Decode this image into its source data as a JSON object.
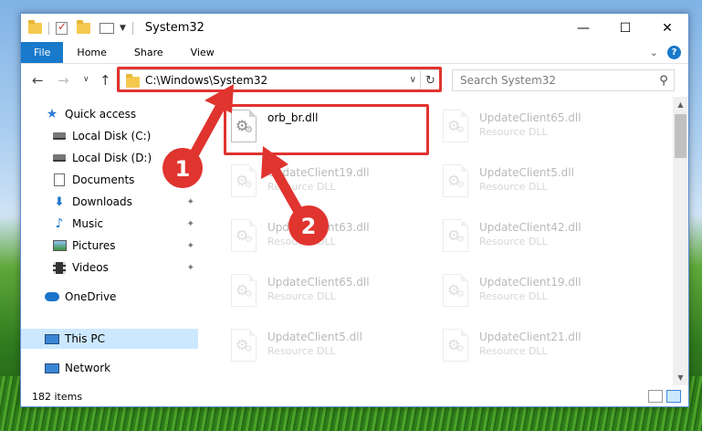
{
  "window": {
    "title": "System32",
    "controls": {
      "minimize": "—",
      "maximize": "☐",
      "close": "✕"
    }
  },
  "ribbon": {
    "tabs": [
      "File",
      "Home",
      "Share",
      "View"
    ],
    "help": "?"
  },
  "nav": {
    "address": "C:\\Windows\\System32",
    "search_placeholder": "Search System32"
  },
  "sidebar": {
    "items": [
      {
        "label": "Quick access",
        "icon": "star-icon",
        "pinned": false
      },
      {
        "label": "Local Disk (C:)",
        "icon": "drive-icon",
        "pinned": false
      },
      {
        "label": "Local Disk (D:)",
        "icon": "drive-icon",
        "pinned": false
      },
      {
        "label": "Documents",
        "icon": "document-icon",
        "pinned": true
      },
      {
        "label": "Downloads",
        "icon": "download-icon",
        "pinned": true
      },
      {
        "label": "Music",
        "icon": "music-icon",
        "pinned": true
      },
      {
        "label": "Pictures",
        "icon": "pictures-icon",
        "pinned": true
      },
      {
        "label": "Videos",
        "icon": "video-icon",
        "pinned": true
      },
      {
        "label": "OneDrive",
        "icon": "cloud-icon",
        "pinned": false
      },
      {
        "label": "This PC",
        "icon": "computer-icon",
        "pinned": false,
        "selected": true
      },
      {
        "label": "Network",
        "icon": "network-icon",
        "pinned": false
      }
    ]
  },
  "files": {
    "highlighted": {
      "name": "orb_br.dll",
      "type": ""
    },
    "items": [
      {
        "name": "UpdateClient65.dll",
        "type": "Resource DLL"
      },
      {
        "name": "UpdateClient19.dll",
        "type": "Resource DLL"
      },
      {
        "name": "UpdateClient5.dll",
        "type": "Resource DLL"
      },
      {
        "name": "UpdateClient63.dll",
        "type": "Resource DLL"
      },
      {
        "name": "UpdateClient42.dll",
        "type": "Resource DLL"
      },
      {
        "name": "UpdateClient65.dll",
        "type": "Resource DLL"
      },
      {
        "name": "UpdateClient19.dll",
        "type": "Resource DLL"
      },
      {
        "name": "UpdateClient5.dll",
        "type": "Resource DLL"
      },
      {
        "name": "UpdateClient21.dll",
        "type": "Resource DLL"
      }
    ]
  },
  "status": {
    "count": "182 items"
  },
  "annotations": {
    "step1": "1",
    "step2": "2",
    "color": "#e0342f"
  }
}
